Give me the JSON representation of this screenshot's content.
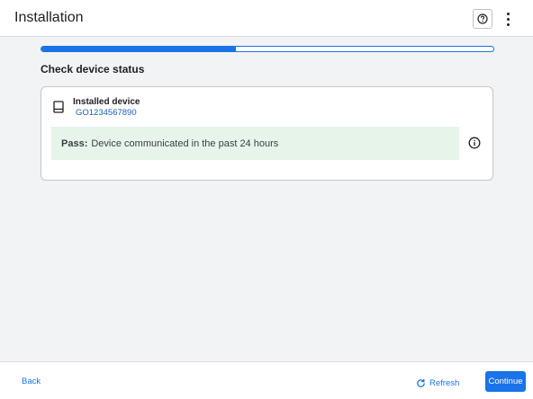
{
  "header": {
    "title": "Installation",
    "help_icon": "help-circle-icon",
    "menu_icon": "more-vertical-icon"
  },
  "progress": {
    "fraction": 0.43
  },
  "section": {
    "heading": "Check device status"
  },
  "device": {
    "icon": "device-icon",
    "title": "Installed device",
    "id": "GO1234567890"
  },
  "status": {
    "label": "Pass:",
    "message": "Device communicated in the past 24 hours",
    "info_icon": "info-icon"
  },
  "footer": {
    "back_label": "Back",
    "refresh_label": "Refresh",
    "refresh_icon": "refresh-icon",
    "continue_label": "Continue"
  },
  "colors": {
    "accent": "#1a73e8",
    "pass_background": "#e6f4ea",
    "page_background": "#f1f3f4"
  }
}
